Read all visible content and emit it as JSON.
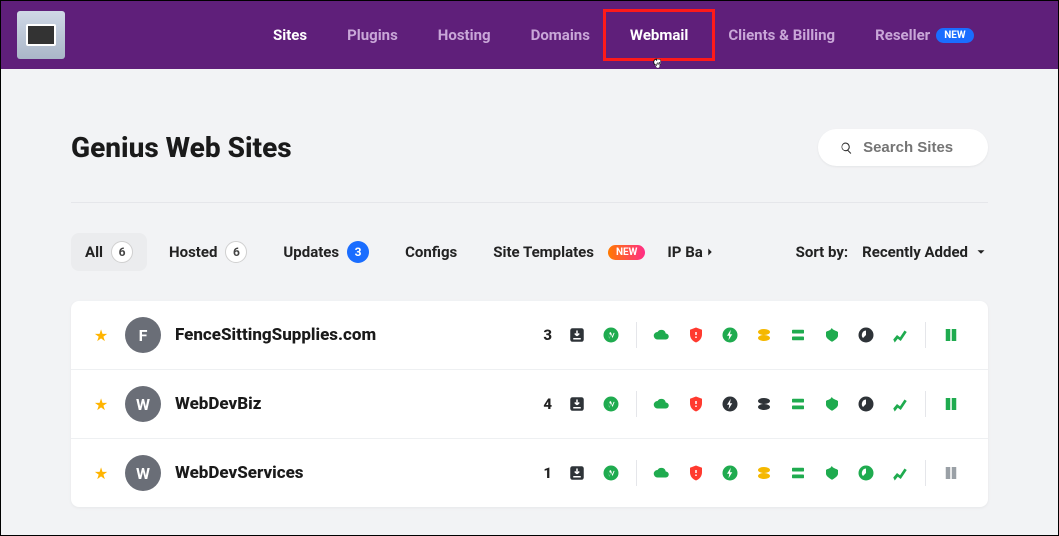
{
  "nav": {
    "items": [
      {
        "label": "Sites",
        "state": "active"
      },
      {
        "label": "Plugins"
      },
      {
        "label": "Hosting"
      },
      {
        "label": "Domains"
      },
      {
        "label": "Webmail",
        "state": "highlight"
      },
      {
        "label": "Clients & Billing"
      },
      {
        "label": "Reseller",
        "badge": "NEW"
      }
    ]
  },
  "page": {
    "title": "Genius Web Sites",
    "search_placeholder": "Search Sites"
  },
  "tabs": {
    "items": [
      {
        "label": "All",
        "count": "6",
        "active": true
      },
      {
        "label": "Hosted",
        "count": "6"
      },
      {
        "label": "Updates",
        "count": "3",
        "count_blue": true
      },
      {
        "label": "Configs"
      },
      {
        "label": "Site Templates",
        "badge": "NEW"
      }
    ],
    "overflow_label": "IP Ba",
    "sort_label": "Sort by:",
    "sort_value": "Recently Added"
  },
  "sites": [
    {
      "initial": "F",
      "name": "FenceSittingSupplies.com",
      "updates": "3",
      "icons": [
        "dl",
        "wp",
        "sep",
        "cloud-g",
        "shield-r",
        "bolt-g",
        "disc-y",
        "stack-g",
        "heart-g",
        "perf-d",
        "chart-g",
        "sep",
        "book-g"
      ]
    },
    {
      "initial": "W",
      "name": "WebDevBiz",
      "updates": "4",
      "icons": [
        "dl",
        "wp",
        "sep",
        "cloud-g",
        "shield-r",
        "bolt-d",
        "disc-d",
        "stack-g",
        "heart-g",
        "perf-d",
        "chart-g",
        "sep",
        "book-g"
      ]
    },
    {
      "initial": "W",
      "name": "WebDevServices",
      "updates": "1",
      "icons": [
        "dl",
        "wp",
        "sep",
        "cloud-g",
        "shield-r",
        "bolt-g",
        "disc-y",
        "stack-g",
        "heart-g",
        "perf-g",
        "chart-g",
        "sep",
        "book-d"
      ]
    }
  ]
}
